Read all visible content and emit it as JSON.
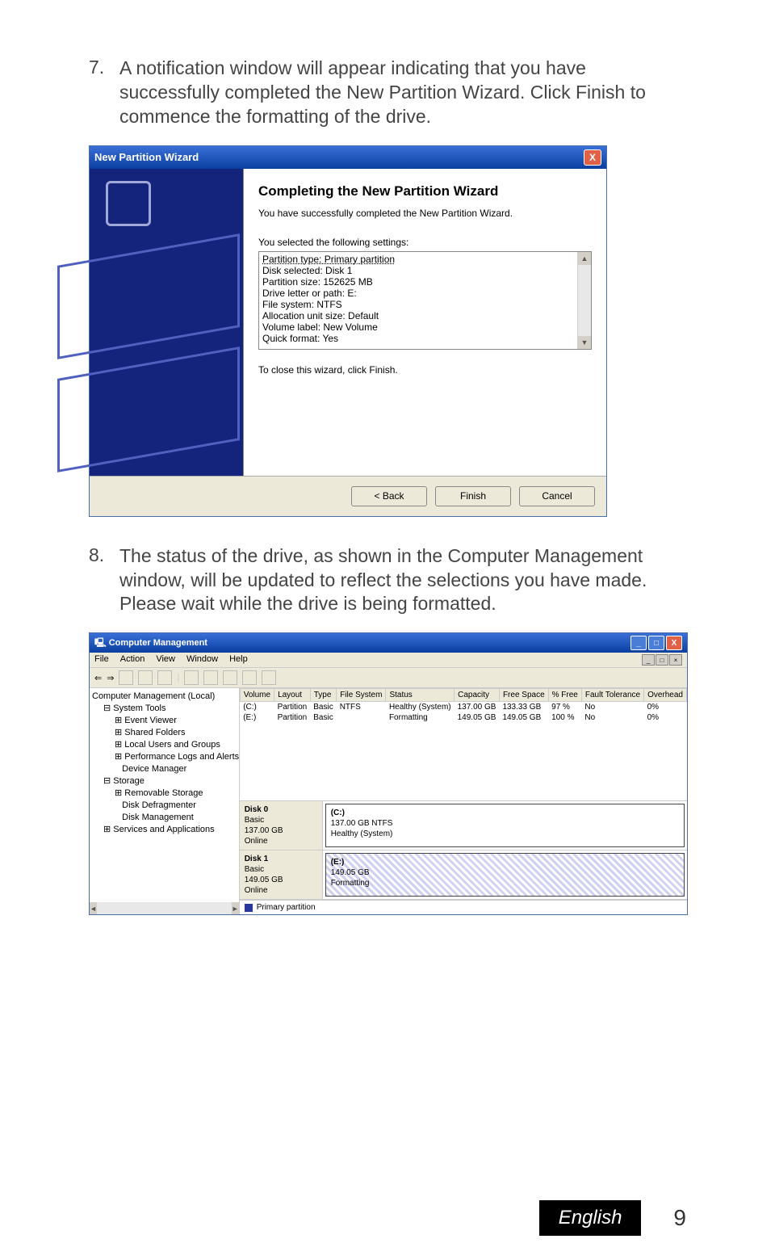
{
  "step7": {
    "num": "7.",
    "text": "A notification window will appear indicating that you have successfully completed the New Partition Wizard. Click Finish to commence the formatting of the drive."
  },
  "wizard": {
    "title": "New Partition Wizard",
    "heading": "Completing the New Partition Wizard",
    "sub": "You have successfully completed the New Partition Wizard.",
    "settings_label": "You selected the following settings:",
    "settings": [
      "Partition type: Primary partition",
      "Disk selected: Disk 1",
      "Partition size: 152625 MB",
      "Drive letter or path: E:",
      "File system: NTFS",
      "Allocation unit size: Default",
      "Volume label: New Volume",
      "Quick format: Yes"
    ],
    "close_hint": "To close this wizard, click Finish.",
    "buttons": {
      "back": "< Back",
      "finish": "Finish",
      "cancel": "Cancel"
    }
  },
  "step8": {
    "num": "8.",
    "text": "The status of the drive, as shown in the Computer Management window, will be updated to reflect the selections you have made. Please wait while the drive is being formatted."
  },
  "cm": {
    "title": "Computer Management",
    "menus": [
      "File",
      "Action",
      "View",
      "Window",
      "Help"
    ],
    "tree": [
      "Computer Management (Local)",
      "System Tools",
      "Event Viewer",
      "Shared Folders",
      "Local Users and Groups",
      "Performance Logs and Alerts",
      "Device Manager",
      "Storage",
      "Removable Storage",
      "Disk Defragmenter",
      "Disk Management",
      "Services and Applications"
    ],
    "columns": [
      "Volume",
      "Layout",
      "Type",
      "File System",
      "Status",
      "Capacity",
      "Free Space",
      "% Free",
      "Fault Tolerance",
      "Overhead"
    ],
    "rows": [
      {
        "vol": "(C:)",
        "layout": "Partition",
        "type": "Basic",
        "fs": "NTFS",
        "status": "Healthy (System)",
        "cap": "137.00 GB",
        "free": "133.33 GB",
        "pct": "97 %",
        "ft": "No",
        "oh": "0%"
      },
      {
        "vol": "(E:)",
        "layout": "Partition",
        "type": "Basic",
        "fs": "",
        "status": "Formatting",
        "cap": "149.05 GB",
        "free": "149.05 GB",
        "pct": "100 %",
        "ft": "No",
        "oh": "0%"
      }
    ],
    "disks": [
      {
        "name": "Disk 0",
        "type": "Basic",
        "size": "137.00 GB",
        "state": "Online",
        "part_label": "(C:)",
        "part_size": "137.00 GB NTFS",
        "part_status": "Healthy (System)",
        "stripe": false
      },
      {
        "name": "Disk 1",
        "type": "Basic",
        "size": "149.05 GB",
        "state": "Online",
        "part_label": "(E:)",
        "part_size": "149.05 GB",
        "part_status": "Formatting",
        "stripe": true
      }
    ],
    "legend": "Primary partition"
  },
  "footer": {
    "lang": "English",
    "page": "9"
  }
}
